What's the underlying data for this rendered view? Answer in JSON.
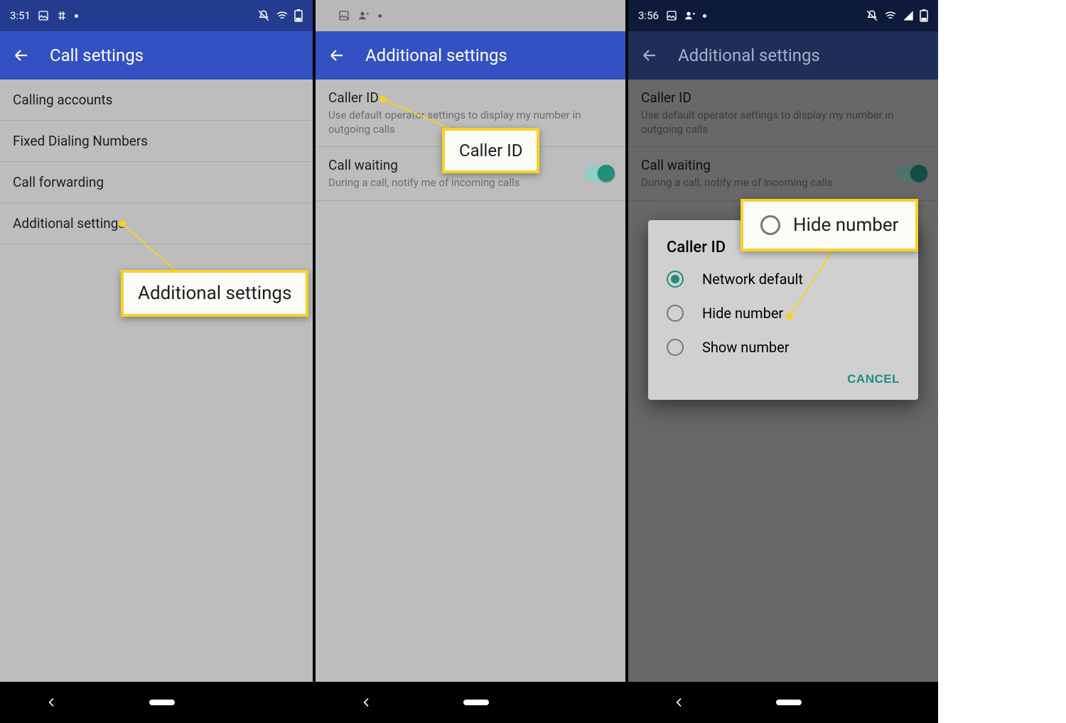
{
  "screen1": {
    "time": "3:51",
    "title": "Call settings",
    "items": [
      "Calling accounts",
      "Fixed Dialing Numbers",
      "Call forwarding",
      "Additional settings"
    ],
    "callout": "Additional settings"
  },
  "screen2": {
    "title": "Additional settings",
    "caller_id": {
      "label": "Caller ID",
      "sub": "Use default operator settings to display my number in outgoing calls"
    },
    "call_waiting": {
      "label": "Call waiting",
      "sub": "During a call, notify me of incoming calls"
    },
    "callout": "Caller ID"
  },
  "screen3": {
    "time": "3:56",
    "title": "Additional settings",
    "caller_id": {
      "label": "Caller ID",
      "sub": "Use default operator settings to display my number in outgoing calls"
    },
    "call_waiting": {
      "label": "Call waiting",
      "sub": "During a call, notify me of incoming calls"
    },
    "dialog": {
      "title": "Caller ID",
      "options": [
        "Network default",
        "Hide number",
        "Show number"
      ],
      "selected": 0,
      "cancel": "CANCEL"
    },
    "callout": "Hide number"
  }
}
